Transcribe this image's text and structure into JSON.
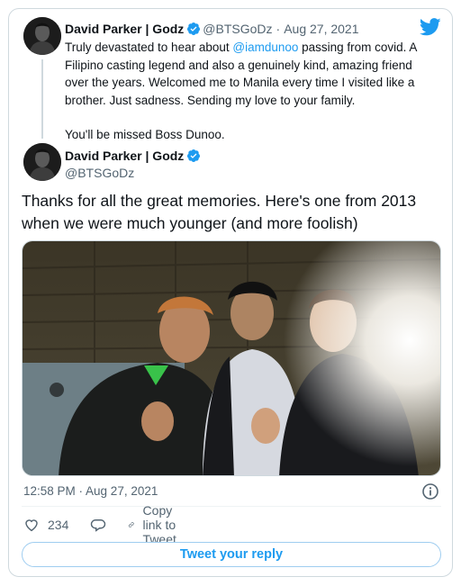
{
  "first_tweet": {
    "author_name": "David Parker | Godz",
    "handle": "@BTSGoDz",
    "separator": "·",
    "date": "Aug 27, 2021",
    "text_before_mention": "Truly devastated to hear about ",
    "mention": "@iamdunoo",
    "text_after_mention": " passing from covid. A Filipino casting legend and also a genuinely kind, amazing friend over the years. Welcomed me to Manila every time I visited like a brother. Just sadness. Sending my love to your family.",
    "closing_line": "You'll be missed Boss Dunoo."
  },
  "main_tweet": {
    "author_name": "David Parker | Godz",
    "handle": "@BTSGoDz",
    "text": "Thanks for all the great memories. Here's one from 2013 when we were much younger (and more foolish)",
    "timestamp": "12:58 PM · Aug 27, 2021",
    "like_count": "234",
    "copy_link_label": "Copy link to Tweet",
    "reply_button_label": "Tweet your reply"
  },
  "icons": {
    "brand": "twitter-bird-icon",
    "verified": "verified-badge-icon",
    "info": "info-icon",
    "like": "heart-icon",
    "reply": "reply-bubble-icon",
    "link": "link-icon"
  },
  "colors": {
    "accent": "#1d9bf0",
    "text": "#0f1419",
    "muted": "#536471",
    "border": "#cfd9de"
  }
}
